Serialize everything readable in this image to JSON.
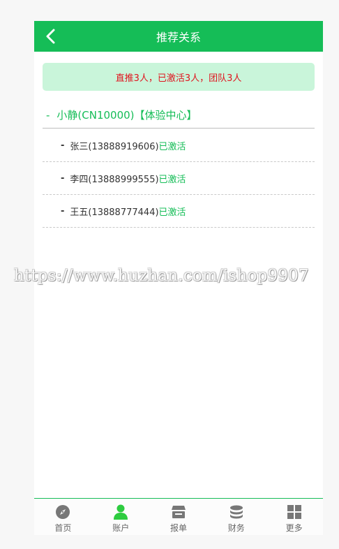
{
  "header": {
    "title": "推荐关系"
  },
  "summary": {
    "text": "直推3人，已激活3人，团队3人"
  },
  "root": {
    "dash": "-",
    "name": "小静(CN10000)【体验中心】"
  },
  "children": [
    {
      "dash": "-",
      "name": "张三(13888919606)",
      "status": "已激活"
    },
    {
      "dash": "-",
      "name": "李四(13888999555)",
      "status": "已激活"
    },
    {
      "dash": "-",
      "name": "王五(13888777444)",
      "status": "已激活"
    }
  ],
  "watermark": {
    "text": "https://www.huzhan.com/ishop9907"
  },
  "tabbar": {
    "items": [
      {
        "label": "首页",
        "icon": "compass-icon"
      },
      {
        "label": "账户",
        "icon": "user-icon",
        "active": true
      },
      {
        "label": "报单",
        "icon": "store-icon"
      },
      {
        "label": "财务",
        "icon": "coins-icon"
      },
      {
        "label": "更多",
        "icon": "grid-icon"
      }
    ]
  },
  "colors": {
    "brand": "#15bd57",
    "summary_bg": "#c9f5da",
    "summary_text": "#e0141e",
    "active_icon": "#2ecc40",
    "inactive_icon": "#777777"
  }
}
